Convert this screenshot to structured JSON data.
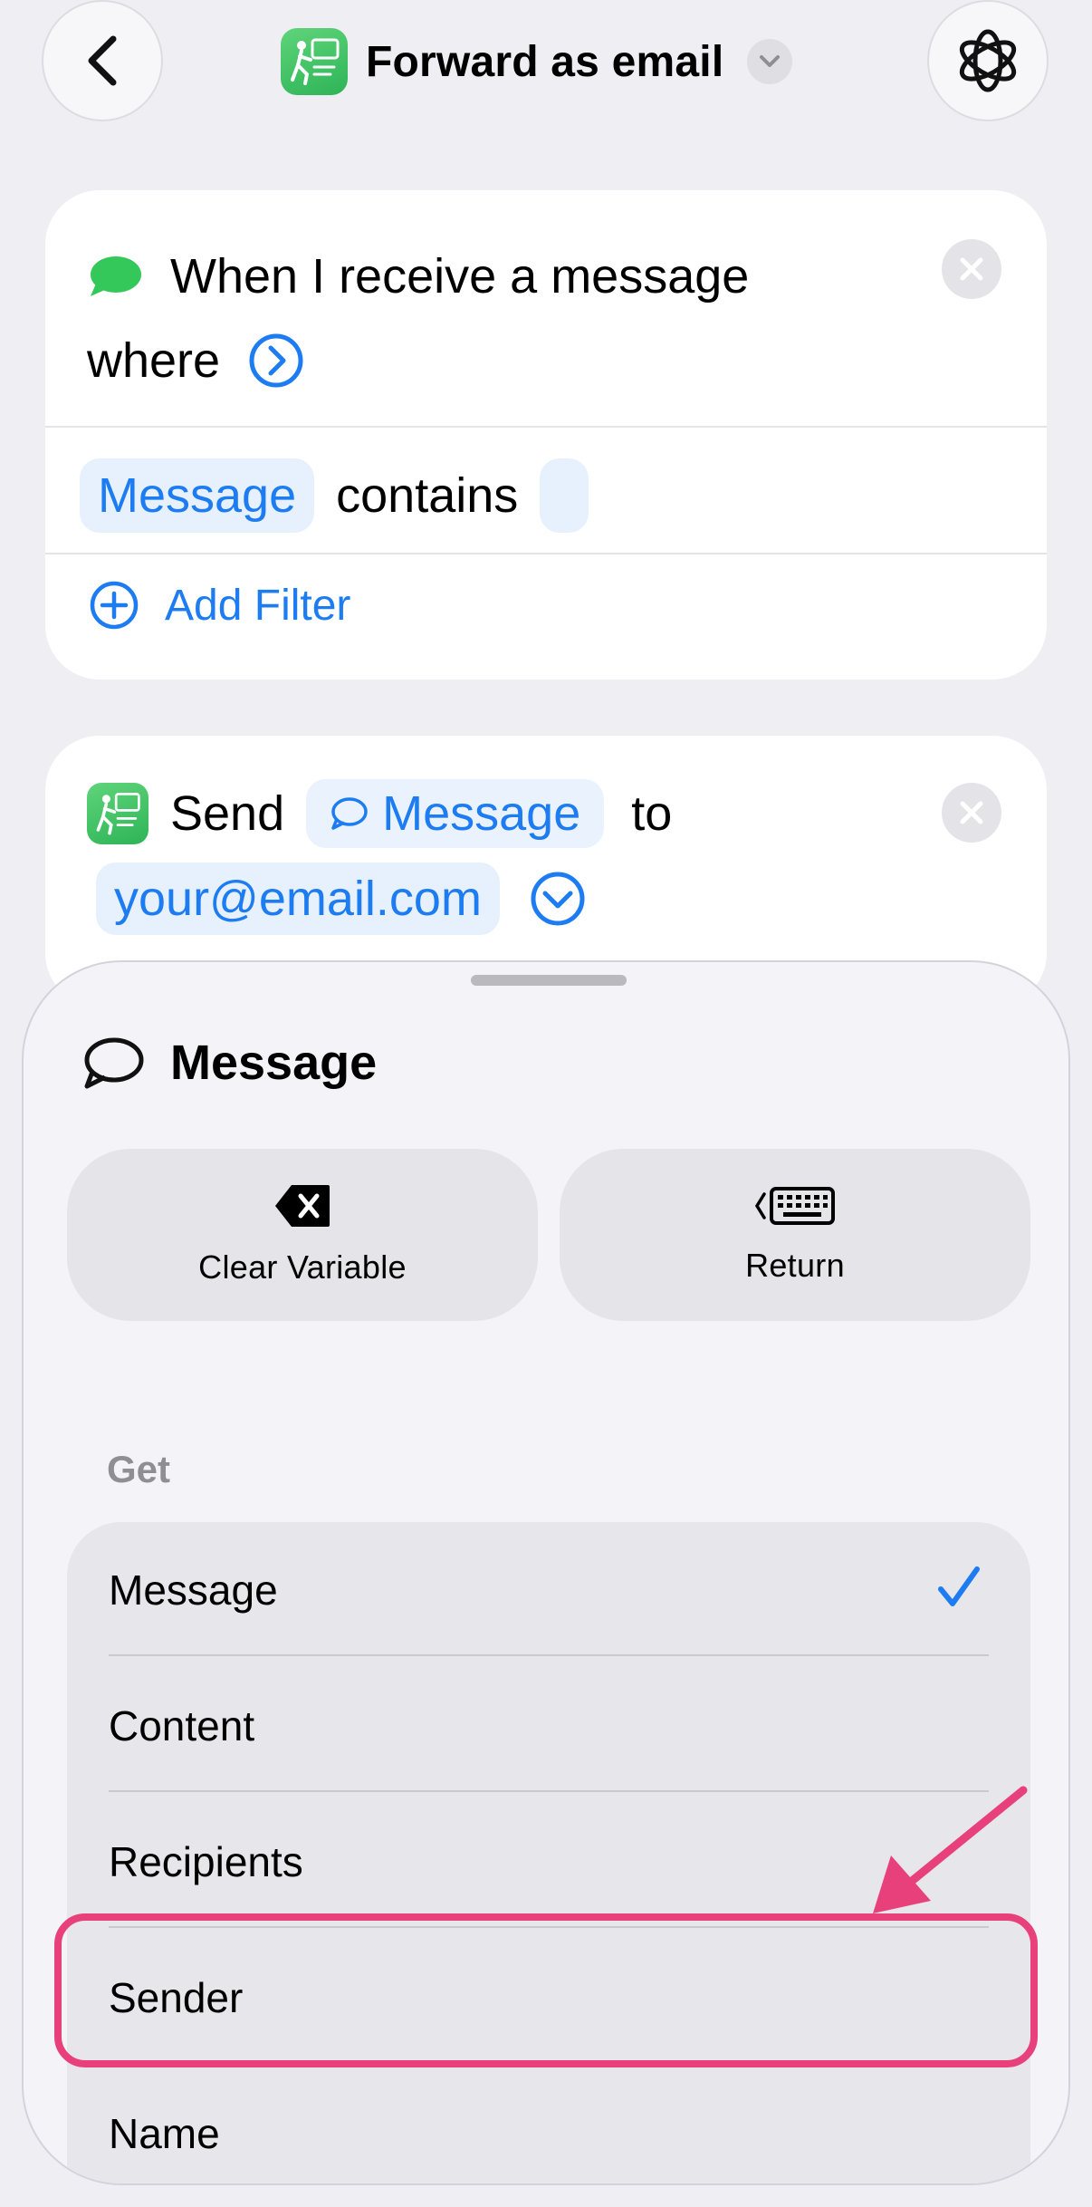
{
  "header": {
    "title": "Forward as email"
  },
  "trigger": {
    "line1": "When I receive a message",
    "line2": "where",
    "filter": {
      "field": "Message",
      "operator": "contains",
      "value": ""
    },
    "add_filter": "Add Filter"
  },
  "action": {
    "verb": "Send",
    "variable": "Message",
    "connector": "to",
    "recipient": "your@email.com"
  },
  "sheet": {
    "title": "Message",
    "clear_label": "Clear Variable",
    "return_label": "Return",
    "section": "Get",
    "items": [
      {
        "label": "Message",
        "selected": true
      },
      {
        "label": "Content",
        "selected": false
      },
      {
        "label": "Recipients",
        "selected": false
      },
      {
        "label": "Sender",
        "selected": false
      },
      {
        "label": "Name",
        "selected": false
      }
    ]
  },
  "colors": {
    "accent": "#1d7cf2",
    "highlight": "#e8407a",
    "app_green": "#34c759"
  }
}
